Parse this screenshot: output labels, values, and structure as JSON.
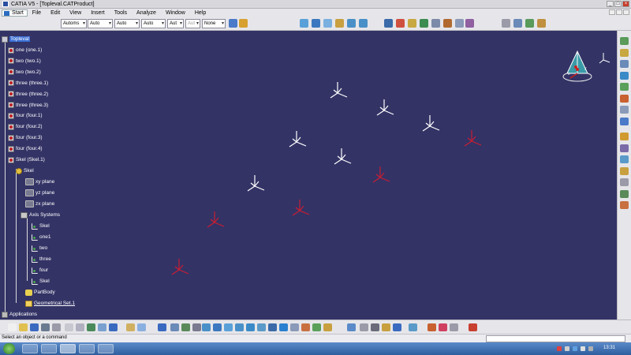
{
  "window": {
    "title": "CATIA V5 - [Topleval.CATProduct]"
  },
  "menu": {
    "start": "Start",
    "items": [
      "File",
      "Edit",
      "View",
      "Insert",
      "Tools",
      "Analyze",
      "Window",
      "Help"
    ]
  },
  "toolbar": {
    "combos": [
      "Automs",
      "Auto",
      "Auto",
      "Auto",
      "Aut",
      "Aut",
      "None"
    ]
  },
  "tree": {
    "root": "Topleval",
    "parts": [
      "one (one.1)",
      "two (two.1)",
      "two (two.2)",
      "three (three.1)",
      "three (three.2)",
      "three (three.3)",
      "four (four.1)",
      "four (four.2)",
      "four (four.3)",
      "four (four.4)",
      "Skel (Skel.1)"
    ],
    "skel": "Skel",
    "planes": [
      "xy plane",
      "yz plane",
      "zx plane"
    ],
    "axis_systems": "Axis Systems",
    "axes": [
      "Skel",
      "one1",
      "two",
      "three",
      "four",
      "Skel"
    ],
    "partbody": "PartBody",
    "geoset": "Geometrical Set.1",
    "applications": "Applications"
  },
  "compass_labels": {
    "x": "x",
    "y": "y",
    "z": "z"
  },
  "status": {
    "message": "Select an object or a command"
  },
  "taskbar": {
    "clock": "13:31"
  },
  "colors": {
    "viewport": "#333366",
    "selected": "#3b6fd4",
    "axis_white": "#ffffff",
    "axis_red": "#c81e32"
  }
}
